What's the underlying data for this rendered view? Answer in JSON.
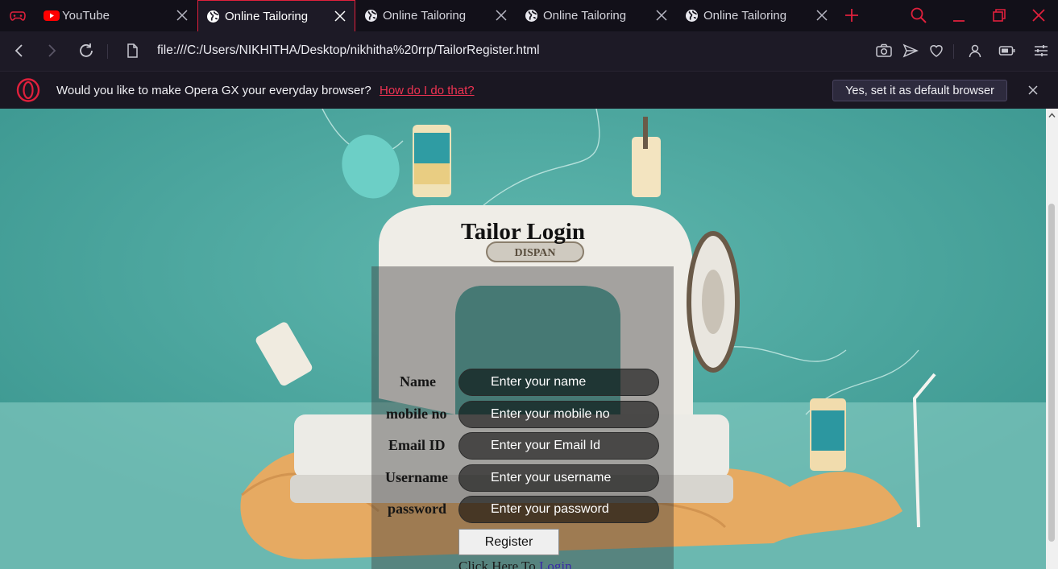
{
  "browser": {
    "tabs": [
      {
        "title": "YouTube",
        "favicon": "youtube-icon",
        "active": false
      },
      {
        "title": "Online Tailoring",
        "favicon": "globe-icon",
        "active": true
      },
      {
        "title": "Online Tailoring",
        "favicon": "globe-icon",
        "active": false
      },
      {
        "title": "Online Tailoring",
        "favicon": "globe-icon",
        "active": false
      },
      {
        "title": "Online Tailoring",
        "favicon": "globe-icon",
        "active": false
      }
    ],
    "address": "file:///C:/Users/NIKHITHA/Desktop/nikhitha%20rrp/TailorRegister.html",
    "accent_color": "#e0203c"
  },
  "infobar": {
    "message": "Would you like to make Opera GX your everyday browser?",
    "link": "How do I do that?",
    "button": "Yes, set it as default browser"
  },
  "page": {
    "title": "Tailor Login",
    "fields": [
      {
        "label": "Name",
        "placeholder": "Enter your name"
      },
      {
        "label": "mobile no",
        "placeholder": "Enter your mobile no"
      },
      {
        "label": "Email ID",
        "placeholder": "Enter your Email Id"
      },
      {
        "label": "Username",
        "placeholder": "Enter your username"
      },
      {
        "label": "password",
        "placeholder": "Enter your password"
      }
    ],
    "register_button": "Register",
    "login_prompt": "Click Here To ",
    "login_link": "Login",
    "background_brand_text": "DISPAN"
  }
}
